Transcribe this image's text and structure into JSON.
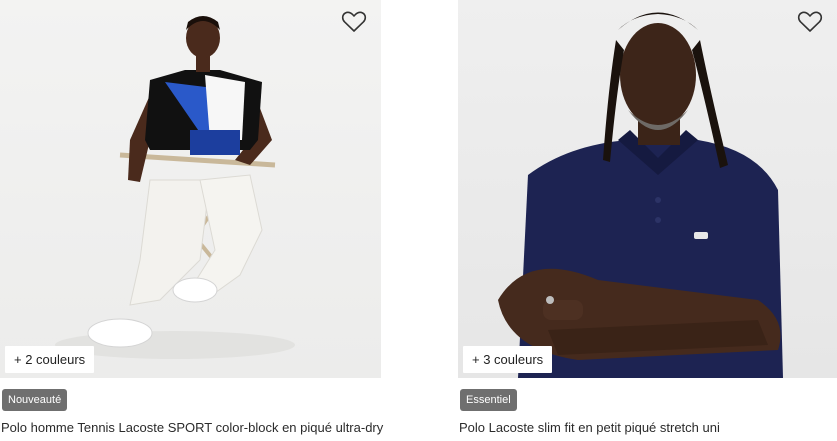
{
  "products": [
    {
      "colors_label": "+ 2 couleurs",
      "badge": "Nouveauté",
      "name": "Polo homme Tennis Lacoste SPORT color-block en piqué ultra-dry"
    },
    {
      "colors_label": "+ 3 couleurs",
      "badge": "Essentiel",
      "name": "Polo Lacoste slim fit en petit piqué stretch uni"
    }
  ],
  "icons": {
    "wishlist": "heart-outline-icon"
  },
  "colors": {
    "badge_bg": "#6f6f6f",
    "badge_text": "#ffffff"
  }
}
